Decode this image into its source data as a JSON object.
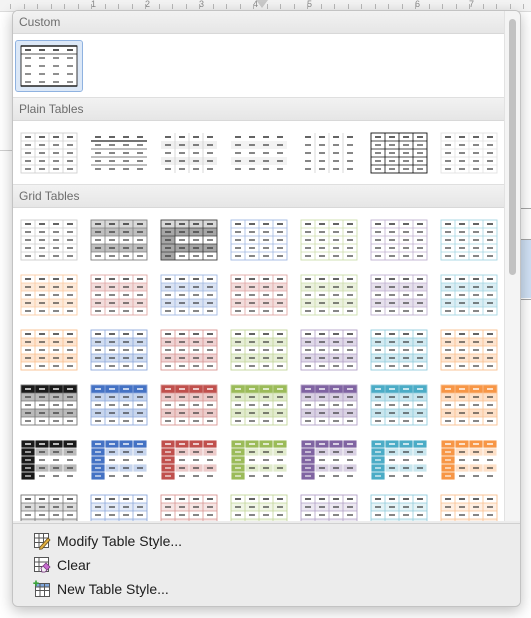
{
  "ruler": {
    "labels": [
      "1",
      "2",
      "3",
      "4",
      "5",
      "6",
      "7"
    ]
  },
  "sections": [
    {
      "title": "Custom",
      "rows": [
        [
          {
            "style": "custom-basic",
            "selected": true
          }
        ]
      ]
    },
    {
      "title": "Plain Tables",
      "rows": [
        [
          {
            "style": "plain-1"
          },
          {
            "style": "plain-2"
          },
          {
            "style": "plain-3"
          },
          {
            "style": "plain-4"
          },
          {
            "style": "plain-5"
          },
          {
            "style": "table-grid"
          },
          {
            "style": "plain-7"
          }
        ]
      ]
    },
    {
      "title": "Grid Tables",
      "rows": [
        [
          {
            "style": "grid-1-light"
          },
          {
            "style": "grid-1-gray"
          },
          {
            "style": "grid-1-dark"
          },
          {
            "style": "grid-1-blue"
          },
          {
            "style": "grid-1-green"
          },
          {
            "style": "grid-1-purple"
          },
          {
            "style": "grid-1-teal"
          }
        ],
        [
          {
            "style": "grid-2-orange"
          },
          {
            "style": "grid-2-red"
          },
          {
            "style": "grid-2-blue"
          },
          {
            "style": "grid-2-red-alt"
          },
          {
            "style": "grid-2-green"
          },
          {
            "style": "grid-2-purple"
          },
          {
            "style": "grid-2-teal"
          }
        ],
        [
          {
            "style": "grid-3-orange"
          },
          {
            "style": "grid-3-blue"
          },
          {
            "style": "grid-3-red"
          },
          {
            "style": "grid-3-green"
          },
          {
            "style": "grid-3-purple"
          },
          {
            "style": "grid-3-teal"
          },
          {
            "style": "grid-3-orange-alt"
          }
        ],
        [
          {
            "style": "grid-4-black"
          },
          {
            "style": "grid-4-blue"
          },
          {
            "style": "grid-4-red"
          },
          {
            "style": "grid-4-green"
          },
          {
            "style": "grid-4-purple"
          },
          {
            "style": "grid-4-teal"
          },
          {
            "style": "grid-4-orange"
          }
        ],
        [
          {
            "style": "grid-5-black"
          },
          {
            "style": "grid-5-blue"
          },
          {
            "style": "grid-5-red"
          },
          {
            "style": "grid-5-green"
          },
          {
            "style": "grid-5-purple"
          },
          {
            "style": "grid-5-teal"
          },
          {
            "style": "grid-5-orange"
          }
        ],
        [
          {
            "style": "grid-6-black"
          },
          {
            "style": "grid-6-blue"
          },
          {
            "style": "grid-6-red"
          },
          {
            "style": "grid-6-green"
          },
          {
            "style": "grid-6-purple"
          },
          {
            "style": "grid-6-teal"
          },
          {
            "style": "grid-6-orange"
          }
        ]
      ]
    }
  ],
  "colors": {
    "black": "#1a1a1a",
    "gray": "#7f7f7f",
    "blue": "#4472c4",
    "red": "#c0504d",
    "green": "#9bbb59",
    "purple": "#8064a2",
    "teal": "#4bacc6",
    "orange": "#f79646",
    "selection": "#8fb2e0"
  },
  "menu": {
    "modify_label": "Modify Table Style...",
    "clear_label": "Clear",
    "new_label": "New Table Style..."
  }
}
